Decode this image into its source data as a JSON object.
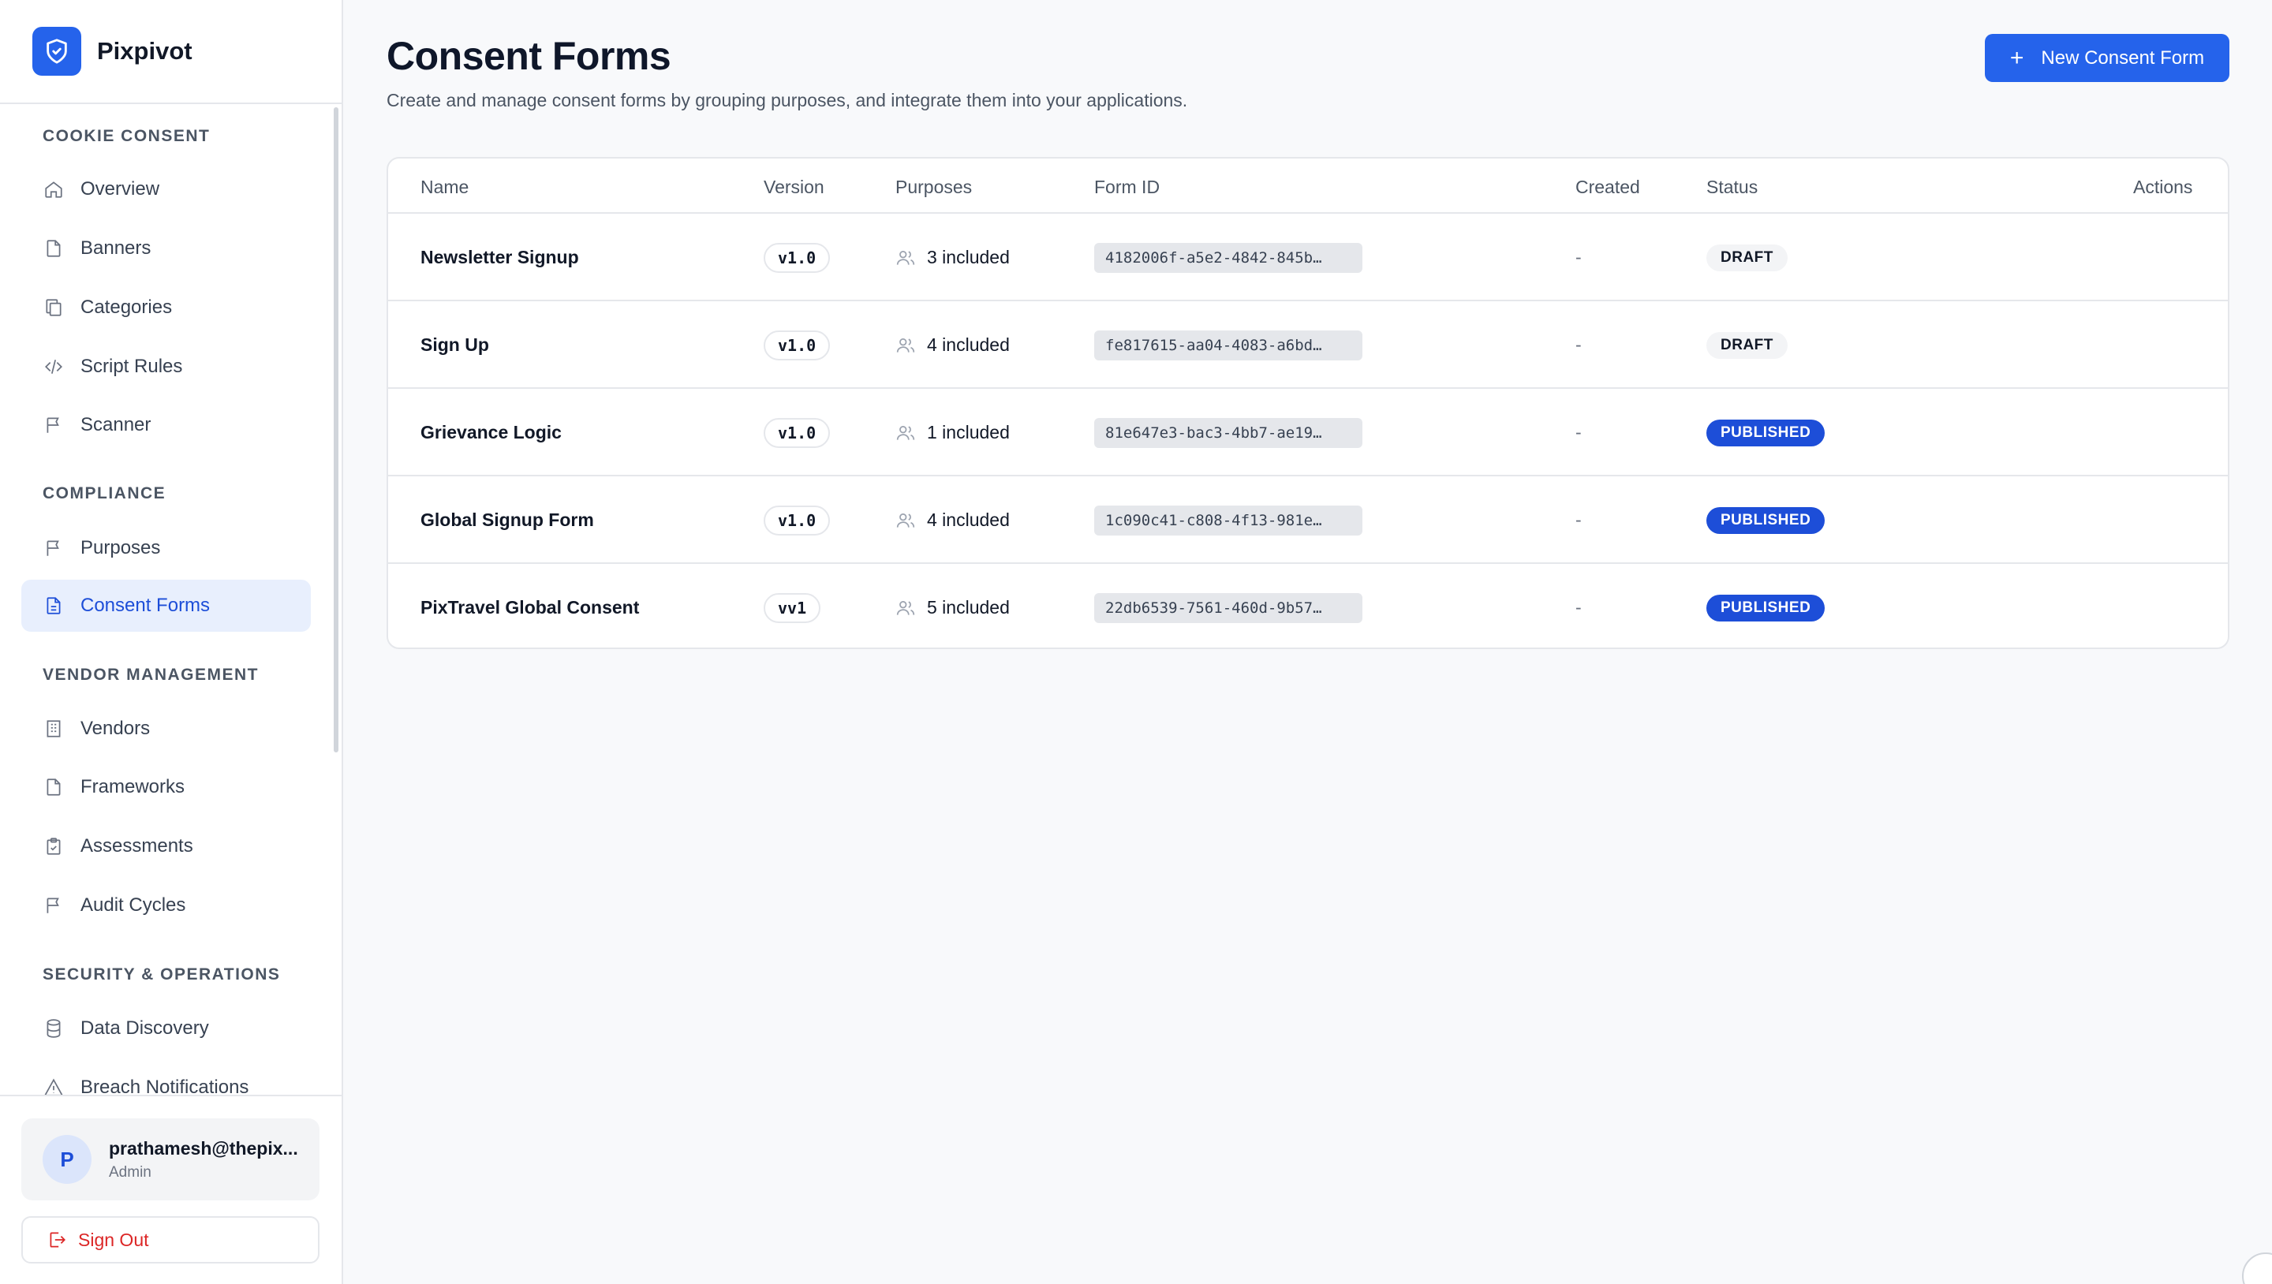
{
  "brand": {
    "name": "Pixpivot"
  },
  "sidebar": {
    "sections": [
      {
        "label": "COOKIE CONSENT",
        "items": [
          {
            "label": "Overview",
            "icon": "home-icon"
          },
          {
            "label": "Banners",
            "icon": "file-icon"
          },
          {
            "label": "Categories",
            "icon": "copy-icon"
          },
          {
            "label": "Script Rules",
            "icon": "code-icon"
          },
          {
            "label": "Scanner",
            "icon": "flag-icon"
          }
        ]
      },
      {
        "label": "COMPLIANCE",
        "items": [
          {
            "label": "Purposes",
            "icon": "flag-icon"
          },
          {
            "label": "Consent Forms",
            "icon": "file-text-icon",
            "active": true
          }
        ]
      },
      {
        "label": "VENDOR MANAGEMENT",
        "items": [
          {
            "label": "Vendors",
            "icon": "building-icon"
          },
          {
            "label": "Frameworks",
            "icon": "file-icon"
          },
          {
            "label": "Assessments",
            "icon": "clipboard-icon"
          },
          {
            "label": "Audit Cycles",
            "icon": "flag-icon"
          }
        ]
      },
      {
        "label": "SECURITY & OPERATIONS",
        "items": [
          {
            "label": "Data Discovery",
            "icon": "database-icon"
          },
          {
            "label": "Breach Notifications",
            "icon": "alert-icon"
          }
        ]
      }
    ]
  },
  "user": {
    "initial": "P",
    "email": "prathamesh@thepix...",
    "role": "Admin"
  },
  "signout": {
    "label": "Sign Out"
  },
  "page": {
    "title": "Consent Forms",
    "subtitle": "Create and manage consent forms by grouping purposes, and integrate them into your applications.",
    "new_button": "New Consent Form"
  },
  "table": {
    "headers": {
      "name": "Name",
      "version": "Version",
      "purposes": "Purposes",
      "form_id": "Form ID",
      "created": "Created",
      "status": "Status",
      "actions": "Actions"
    },
    "rows": [
      {
        "name": "Newsletter Signup",
        "version": "v1.0",
        "purposes": "3 included",
        "form_id": "4182006f-a5e2-4842-845b…",
        "created": "-",
        "status": "DRAFT"
      },
      {
        "name": "Sign Up",
        "version": "v1.0",
        "purposes": "4 included",
        "form_id": "fe817615-aa04-4083-a6bd…",
        "created": "-",
        "status": "DRAFT"
      },
      {
        "name": "Grievance Logic",
        "version": "v1.0",
        "purposes": "1 included",
        "form_id": "81e647e3-bac3-4bb7-ae19…",
        "created": "-",
        "status": "PUBLISHED"
      },
      {
        "name": "Global Signup Form",
        "version": "v1.0",
        "purposes": "4 included",
        "form_id": "1c090c41-c808-4f13-981e…",
        "created": "-",
        "status": "PUBLISHED"
      },
      {
        "name": "PixTravel Global Consent",
        "version": "vv1",
        "purposes": "5 included",
        "form_id": "22db6539-7561-460d-9b57…",
        "created": "-",
        "status": "PUBLISHED"
      }
    ]
  },
  "colors": {
    "accent": "#2563eb",
    "published": "#1d4ed8",
    "danger": "#dc2626"
  }
}
